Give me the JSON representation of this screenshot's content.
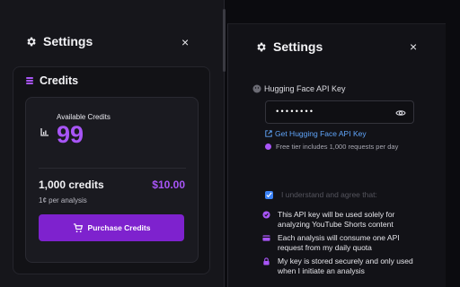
{
  "left_panel": {
    "header": {
      "title": "Settings",
      "close": "×"
    },
    "section": {
      "title": "Credits"
    },
    "card": {
      "available_label": "Available Credits",
      "available_value": "99",
      "pack_name": "1,000 credits",
      "pack_price": "$10.00",
      "pack_sub": "1¢ per analysis",
      "buy_label": "Purchase Credits"
    }
  },
  "right_panel": {
    "header": {
      "title": "Settings",
      "close": "×"
    },
    "api": {
      "label": "Hugging Face API Key",
      "value": "••••••••",
      "link": "Get Hugging Face API Key",
      "free_tier": "Free tier includes 1,000 requests per day"
    },
    "agree": "I understand and agree that:",
    "terms": [
      "This API key will be used solely for analyzing YouTube Shorts content",
      "Each analysis will consume one API request from my daily quota",
      "My key is stored securely and only used when I initiate an analysis"
    ]
  },
  "colors": {
    "accent": "#a855f7",
    "button": "#7e22ce",
    "link": "#60a5fa",
    "checkbox": "#3b82f6"
  }
}
